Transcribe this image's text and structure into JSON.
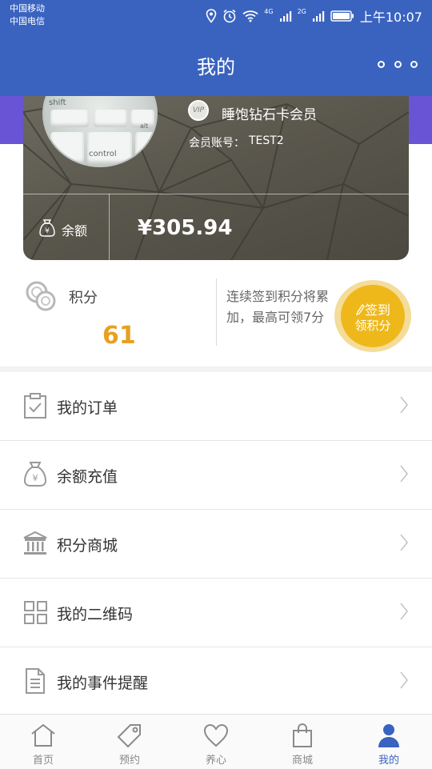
{
  "status_bar": {
    "carrier_1": "中国移动",
    "carrier_2": "中国电信",
    "net_1": "4G",
    "net_2": "2G",
    "time": "上午10:07",
    "icons": [
      "location-icon",
      "alarm-icon",
      "wifi-icon",
      "signal-icon",
      "battery-icon"
    ]
  },
  "header": {
    "title": "我的",
    "more_icon": "more-icon"
  },
  "member_card": {
    "vip_badge": "VIP",
    "level": "睡饱钻石卡会员",
    "account_label": "会员账号：",
    "account_value": "TEST2",
    "balance_label": "余额",
    "balance_value": "¥305.94",
    "avatar_keys": [
      "shift",
      "alt",
      "control"
    ]
  },
  "points": {
    "label": "积分",
    "value": "61",
    "description": "连续签到积分将累加，最高可领7分",
    "checkin_line1": "签到",
    "checkin_line2": "领积分"
  },
  "menu": [
    {
      "label": "我的订单",
      "icon": "clipboard-check-icon"
    },
    {
      "label": "余额充值",
      "icon": "money-bag-icon"
    },
    {
      "label": "积分商城",
      "icon": "bank-icon"
    },
    {
      "label": "我的二维码",
      "icon": "qr-grid-icon"
    },
    {
      "label": "我的事件提醒",
      "icon": "document-icon"
    }
  ],
  "bottom_nav": [
    {
      "label": "首页",
      "icon": "home-icon"
    },
    {
      "label": "预约",
      "icon": "tag-icon"
    },
    {
      "label": "养心",
      "icon": "heart-icon"
    },
    {
      "label": "商城",
      "icon": "shopping-bag-icon"
    },
    {
      "label": "我的",
      "icon": "user-icon",
      "active": true
    }
  ],
  "colors": {
    "primary": "#3a63c0",
    "accent_purple": "#6a54d6",
    "points_orange": "#e8a020",
    "checkin_yellow": "#efb81a"
  }
}
